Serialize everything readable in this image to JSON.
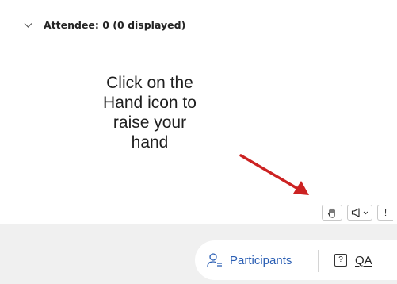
{
  "attendee_section": {
    "label": "Attendee: 0 (0 displayed)"
  },
  "instruction": {
    "text": "Click on the\nHand icon to\nraise your\nhand"
  },
  "reactions": {
    "more_label": "!"
  },
  "bottom_tabs": {
    "participants_label": "Participants",
    "qa_icon_text": "?",
    "qa_label": "QA"
  },
  "colors": {
    "accent": "#2b5fb4",
    "arrow": "#cc2222",
    "toolbar_bg": "#f0f0f0"
  },
  "icons": [
    "chevron-down-icon",
    "hand-icon",
    "megaphone-icon",
    "participants-icon",
    "question-box-icon"
  ]
}
